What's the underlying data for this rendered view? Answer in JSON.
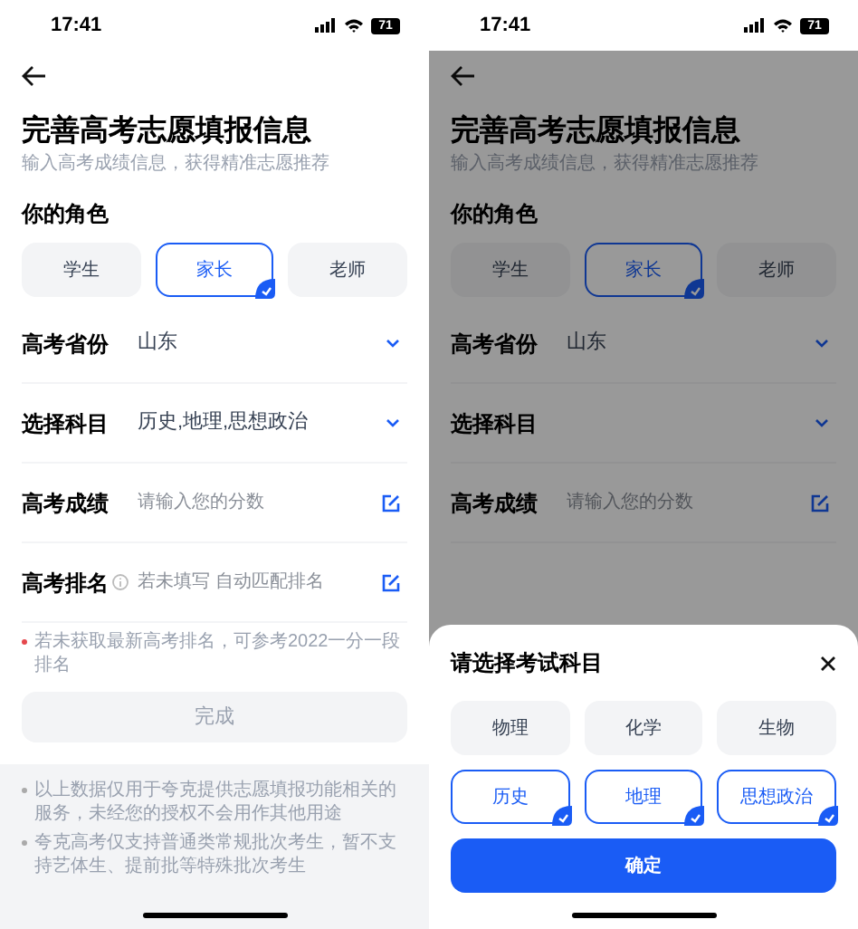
{
  "screens": [
    {
      "status_bar": {
        "time": "17:41",
        "battery": "71"
      },
      "dimmed": false,
      "title": "完善高考志愿填报信息",
      "subtitle": "输入高考成绩信息，获得精准志愿推荐",
      "role_label": "你的角色",
      "roles": [
        {
          "label": "学生",
          "selected": false
        },
        {
          "label": "家长",
          "selected": true
        },
        {
          "label": "老师",
          "selected": false
        }
      ],
      "fields": [
        {
          "kind": "select",
          "label": "高考省份",
          "value": "山东"
        },
        {
          "kind": "select",
          "label": "选择科目",
          "value": "历史,地理,思想政治"
        },
        {
          "kind": "input",
          "label": "高考成绩",
          "placeholder": "请输入您的分数",
          "info": false
        },
        {
          "kind": "input",
          "label": "高考排名",
          "placeholder": "若未填写 自动匹配排名",
          "info": true
        }
      ],
      "footnote": "若未获取最新高考排名，可参考2022一分一段排名",
      "submit": {
        "label": "完成",
        "disabled": true
      },
      "notices": [
        "以上数据仅用于夸克提供志愿填报功能相关的服务，未经您的授权不会用作其他用途",
        "夸克高考仅支持普通类常规批次考生，暂不支持艺体生、提前批等特殊批次考生"
      ]
    },
    {
      "status_bar": {
        "time": "17:41",
        "battery": "71"
      },
      "dimmed": true,
      "title": "完善高考志愿填报信息",
      "subtitle": "输入高考成绩信息，获得精准志愿推荐",
      "role_label": "你的角色",
      "roles": [
        {
          "label": "学生",
          "selected": false
        },
        {
          "label": "家长",
          "selected": true
        },
        {
          "label": "老师",
          "selected": false
        }
      ],
      "fields": [
        {
          "kind": "select",
          "label": "高考省份",
          "value": "山东"
        },
        {
          "kind": "select",
          "label": "选择科目"
        },
        {
          "kind": "input",
          "label": "高考成绩",
          "placeholder": "请输入您的分数",
          "info": false
        }
      ],
      "sheet": {
        "title": "请选择考试科目",
        "options": [
          {
            "label": "物理",
            "selected": false
          },
          {
            "label": "化学",
            "selected": false
          },
          {
            "label": "生物",
            "selected": false
          },
          {
            "label": "历史",
            "selected": true
          },
          {
            "label": "地理",
            "selected": true
          },
          {
            "label": "思想政治",
            "selected": true
          }
        ],
        "confirm": "确定"
      }
    }
  ]
}
